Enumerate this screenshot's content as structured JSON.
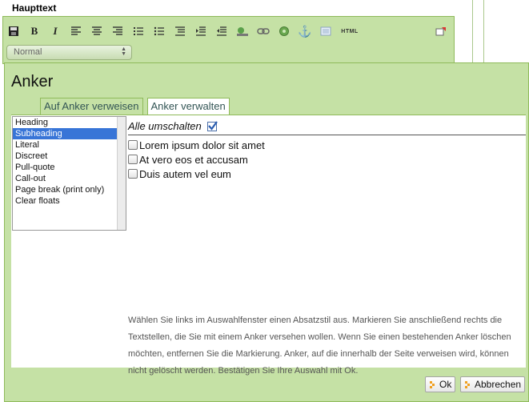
{
  "section_title": "Haupttext",
  "toolbar": {
    "format_value": "Normal",
    "html_label": "HTML",
    "tools": [
      "save-icon",
      "bold-icon",
      "italic-icon",
      "align-left-icon",
      "align-center-icon",
      "align-right-icon",
      "ordered-list-icon",
      "unordered-list-icon",
      "outdent-icon",
      "indent-left-icon",
      "indent-right-icon",
      "image-icon",
      "link-icon",
      "unlink-icon",
      "anchor-icon",
      "media-icon",
      "html-icon",
      "maximize-icon"
    ],
    "bold_label": "B",
    "italic_label": "I",
    "anchor_glyph": "⚓"
  },
  "dialog": {
    "title": "Anker",
    "tabs": [
      {
        "label": "Auf Anker verweisen",
        "active": false
      },
      {
        "label": "Anker verwalten",
        "active": true
      }
    ],
    "styles": [
      "Heading",
      "Subheading",
      "Literal",
      "Discreet",
      "Pull-quote",
      "Call-out",
      "Page break (print only)",
      "Clear floats"
    ],
    "selected_style": "Subheading",
    "toggle_all_label": "Alle umschalten",
    "anchors": [
      "Lorem ipsum dolor sit amet",
      "At vero eos et accusam",
      "Duis autem vel eum"
    ],
    "help_text": "Wählen Sie links im Auswahlfenster einen Absatzstil aus. Markieren Sie anschließend rechts die Textstellen, die Sie mit einem Anker versehen wollen. Wenn Sie einen bestehenden Anker löschen möchten, entfernen Sie die Markierung. Anker, auf die innerhalb der Seite verweisen wird, können nicht gelöscht werden. Bestätigen Sie Ihre Auswahl mit Ok.",
    "ok_label": "Ok",
    "cancel_label": "Abbrechen"
  },
  "colors": {
    "panel": "#c5e1a5",
    "border": "#8fba5a",
    "selection": "#3875d7"
  }
}
